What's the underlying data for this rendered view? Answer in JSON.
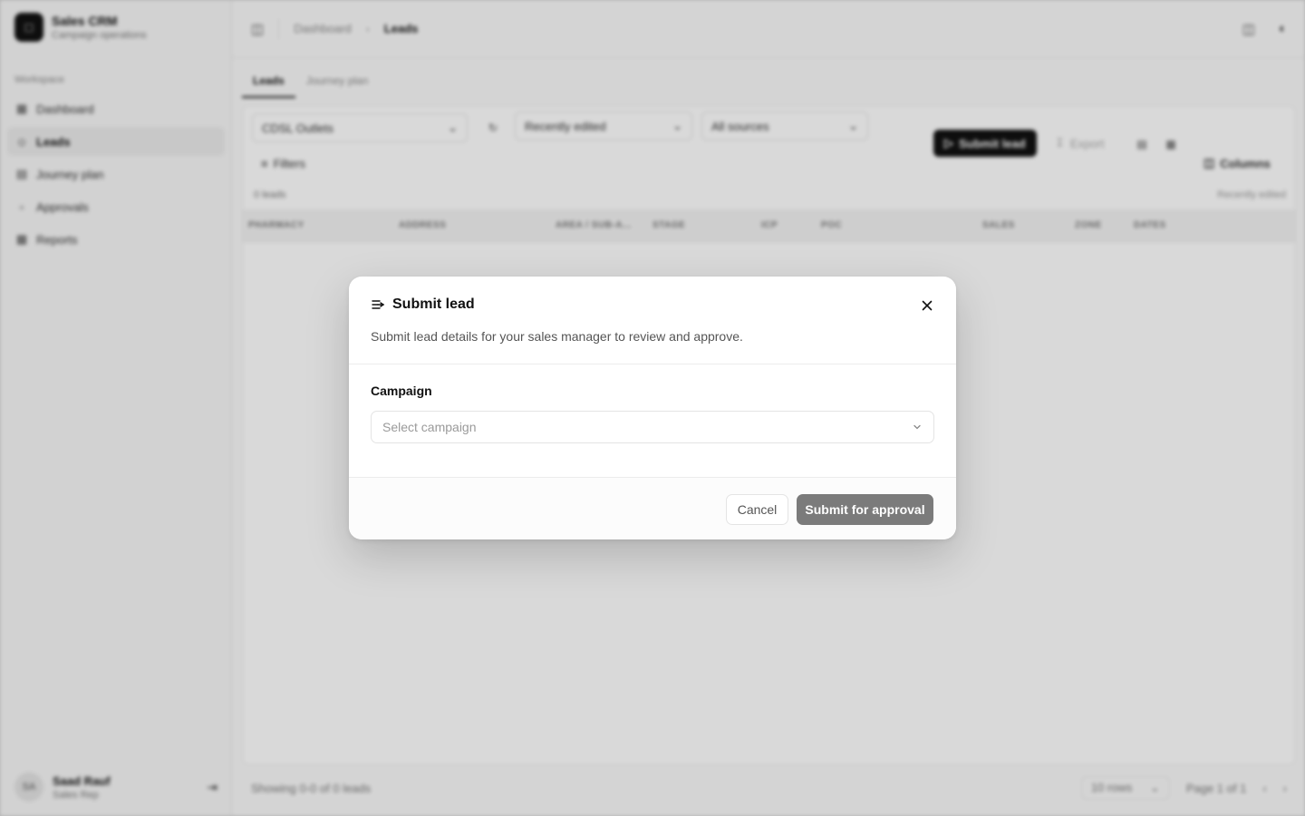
{
  "app": {
    "name": "Sales CRM",
    "subtitle": "Campaign operations",
    "workspace_label": "Workspace",
    "nav": [
      {
        "label": "Dashboard",
        "icon": "grid-icon"
      },
      {
        "label": "Leads",
        "icon": "users-icon"
      },
      {
        "label": "Journey plan",
        "icon": "calendar-icon"
      },
      {
        "label": "Approvals",
        "icon": "clipboard-icon"
      },
      {
        "label": "Reports",
        "icon": "chart-icon"
      }
    ],
    "active_nav": "Leads",
    "user": {
      "initials": "SA",
      "name": "Saad Rauf",
      "role": "Sales Rep"
    }
  },
  "header": {
    "breadcrumb": [
      "Dashboard",
      "Leads"
    ]
  },
  "tabs": [
    "Leads",
    "Journey plan"
  ],
  "active_tab": "Leads",
  "toolbar": {
    "campaign_filter": "CDSL Outlets",
    "sort": "Recently edited",
    "source": "All sources",
    "filters_label": "Filters",
    "submit_lead_label": "Submit lead",
    "export_label": "Export",
    "columns_label": "Columns"
  },
  "table": {
    "count_label": "0 leads",
    "sort_note": "Recently edited",
    "columns": [
      "PHARMACY",
      "ADDRESS",
      "AREA / SUB-A...",
      "STAGE",
      "ICP",
      "POC",
      "SALES",
      "ZONE",
      "DATES"
    ]
  },
  "footer": {
    "showing": "Showing 0-0 of 0 leads",
    "rows": "10 rows",
    "page": "Page 1 of 1"
  },
  "dialog": {
    "title": "Submit lead",
    "description": "Submit lead details for your sales manager to review and approve.",
    "field_label": "Campaign",
    "select_placeholder": "Select campaign",
    "cancel_label": "Cancel",
    "submit_label": "Submit for approval",
    "submit_color": "#7b7b7b"
  }
}
